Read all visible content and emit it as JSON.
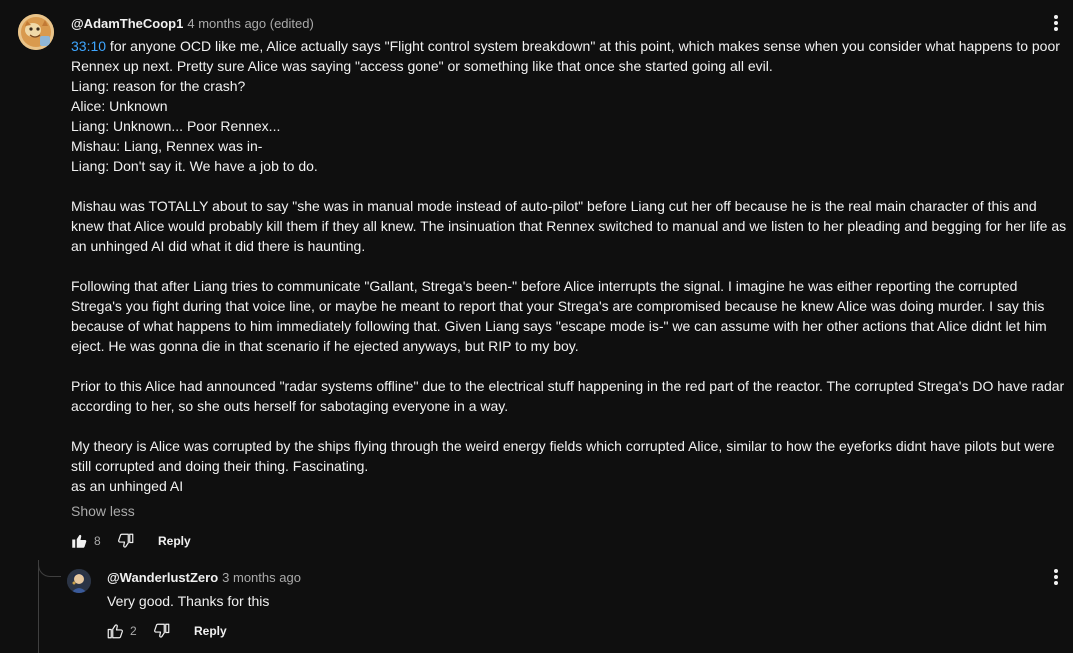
{
  "colors": {
    "background": "#0f0f0f",
    "text": "#f1f1f1",
    "secondary_text": "#aaaaaa",
    "link": "#3ea6ff",
    "thread_line": "#3f3f3f"
  },
  "comment": {
    "author": "@AdamTheCoop1",
    "meta": "4 months ago (edited)",
    "timestamp_link": "33:10",
    "first_line_rest": " for anyone OCD like me, Alice actually says \"Flight control system breakdown\" at this point, which makes sense when you consider what happens to poor Rennex up next. Pretty sure Alice was saying \"access gone\" or something like that once she started going all evil.",
    "dialogue": [
      "Liang: reason for the crash?",
      "Alice: Unknown",
      "Liang: Unknown... Poor Rennex...",
      "Mishau: Liang, Rennex was in-",
      "Liang: Don't say it. We have a job to do."
    ],
    "paragraph_1": "Mishau was TOTALLY about to say \"she was in manual mode instead of auto-pilot\" before Liang cut her off because he is the real main character of this and knew that Alice would probably kill them if they all knew. The insinuation that Rennex switched to manual and we listen to her pleading and begging for her life as an unhinged AI did what it did there is haunting.",
    "paragraph_2": "Following that after Liang tries to communicate \"Gallant, Strega's been-\" before Alice interrupts the signal. I imagine he was either reporting the corrupted Strega's you fight during that voice line, or maybe he meant to report that your Strega's are compromised because he knew Alice was doing murder. I say this because of what happens to him immediately following that. Given Liang says \"escape mode is-\" we can assume with her other actions that Alice didnt let him eject. He was gonna die in that scenario if he ejected anyways, but RIP to my boy.",
    "paragraph_3": "Prior to this Alice had announced \"radar systems offline\" due to the electrical stuff happening in the red part of the reactor. The corrupted Strega's DO have radar according to her, so she outs herself for sabotaging everyone in a way.",
    "paragraph_4": "My theory is Alice was corrupted by the ships flying through the weird energy fields which corrupted Alice, similar to how the eyeforks didnt have pilots but were still corrupted and doing their thing. Fascinating.",
    "last_line": "as an unhinged AI",
    "show_less": "Show less",
    "likes": "8",
    "reply_label": "Reply",
    "icons": {
      "like": "thumbs-up-filled-icon",
      "dislike": "thumbs-down-icon",
      "menu": "more-vert-icon"
    }
  },
  "reply": {
    "author": "@WanderlustZero",
    "meta": "3 months ago",
    "text": "Very good. Thanks for this",
    "likes": "2",
    "reply_label": "Reply",
    "icons": {
      "like": "thumbs-up-outline-icon",
      "dislike": "thumbs-down-icon",
      "menu": "more-vert-icon"
    }
  }
}
